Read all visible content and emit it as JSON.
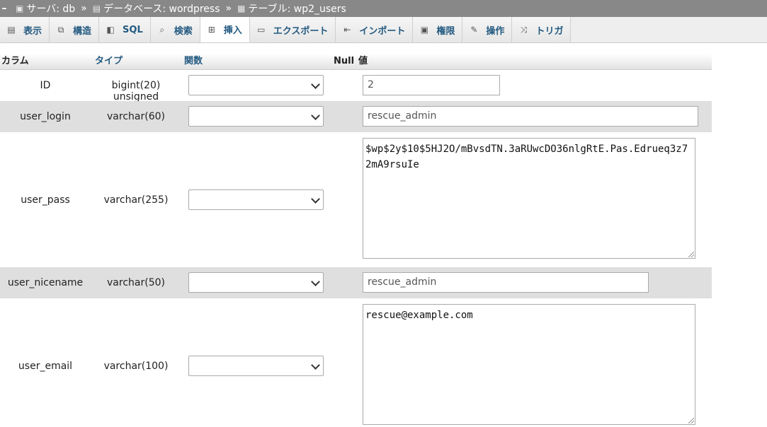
{
  "breadcrumb": {
    "collapse": "–",
    "server_label": "サーバ: db",
    "database_label": "データベース: wordpress",
    "table_label": "テーブル: wp2_users",
    "separator": "»"
  },
  "tabs": [
    {
      "label": "表示",
      "icon": "browse-icon"
    },
    {
      "label": "構造",
      "icon": "structure-icon"
    },
    {
      "label": "SQL",
      "icon": "sql-icon"
    },
    {
      "label": "検索",
      "icon": "search-icon"
    },
    {
      "label": "挿入",
      "icon": "insert-icon",
      "active": true
    },
    {
      "label": "エクスポート",
      "icon": "export-icon"
    },
    {
      "label": "インポート",
      "icon": "import-icon"
    },
    {
      "label": "権限",
      "icon": "privileges-icon"
    },
    {
      "label": "操作",
      "icon": "operations-icon"
    },
    {
      "label": "トリガ",
      "icon": "triggers-icon"
    }
  ],
  "header": {
    "column": "カラム",
    "type": "タイプ",
    "function": "関数",
    "null": "Null",
    "value": "値"
  },
  "rows": [
    {
      "column": "ID",
      "type": "bigint(20) unsigned",
      "function": "",
      "value": "2"
    },
    {
      "column": "user_login",
      "type": "varchar(60)",
      "function": "",
      "value": "rescue_admin"
    },
    {
      "column": "user_pass",
      "type": "varchar(255)",
      "function": "",
      "value": "$wp$2y$10$5HJ2O/mBvsdTN.3aRUwcDO36nlgRtE.Pas.Edrueq3z72mA9rsuIe"
    },
    {
      "column": "user_nicename",
      "type": "varchar(50)",
      "function": "",
      "value": "rescue_admin"
    },
    {
      "column": "user_email",
      "type": "varchar(100)",
      "function": "",
      "value": "rescue@example.com"
    }
  ],
  "colors": {
    "breadcrumb_bg": "#888888",
    "link": "#235a81",
    "row_shade": "#dfdfdf"
  }
}
